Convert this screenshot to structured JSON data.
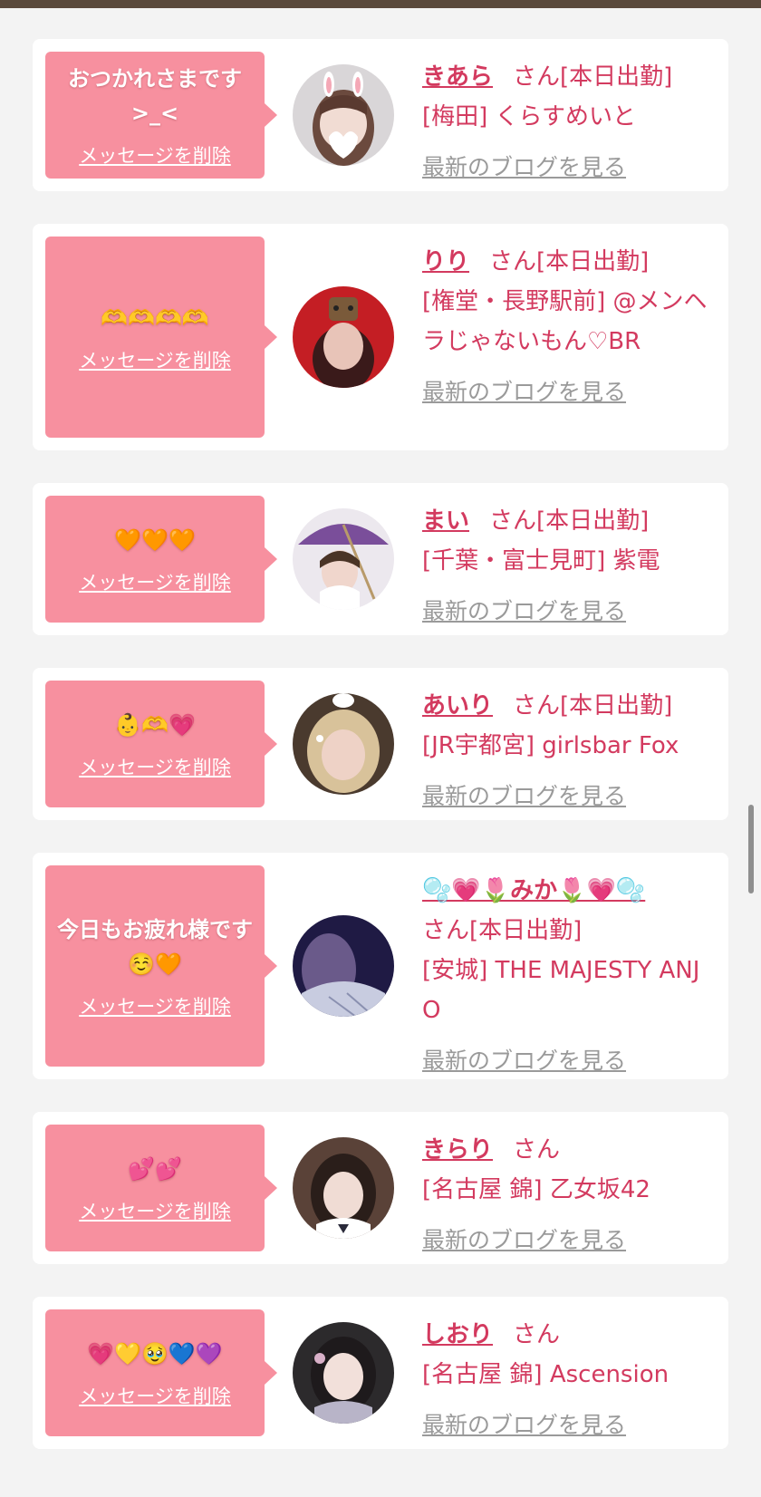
{
  "colors": {
    "bubble": "#f7909f",
    "accent_text": "#d33a5f",
    "blog_link": "#9a9a9a",
    "card": "#ffffff",
    "page_bg": "#f3f3f3"
  },
  "cards": [
    {
      "message": "おつかれさまです >_<",
      "delete_label": "メッセージを削除",
      "name": "きあら",
      "san": "さん",
      "status": "[本日出勤]",
      "shop": "[梅田] くらすめいと",
      "blog_label": "最新のブログを見る",
      "avatar_icon": "girl-avatar-bunny-ears"
    },
    {
      "message": "🫶🫶🫶🫶",
      "delete_label": "メッセージを削除",
      "name": "りり",
      "san": "さん",
      "status": "[本日出勤]",
      "shop": "[権堂・長野駅前] @メンヘラじゃないもん♡BR",
      "blog_label": "最新のブログを見る",
      "avatar_icon": "girl-avatar-red"
    },
    {
      "message": "🧡🧡🧡",
      "delete_label": "メッセージを削除",
      "name": "まい",
      "san": "さん",
      "status": "[本日出勤]",
      "shop": "[千葉・富士見町] 紫電",
      "blog_label": "最新のブログを見る",
      "avatar_icon": "girl-avatar-umbrella"
    },
    {
      "message": "👶🫶💗",
      "delete_label": "メッセージを削除",
      "name": "あいり",
      "san": "さん",
      "status": "[本日出勤]",
      "shop": "[JR宇都宮] girlsbar Fox",
      "blog_label": "最新のブログを見る",
      "avatar_icon": "girl-avatar-blonde"
    },
    {
      "message": "今日もお疲れ様です☺️🧡",
      "delete_label": "メッセージを削除",
      "name": "🫧💗🌷みか🌷💗🫧",
      "san": "さん",
      "status": "[本日出勤]",
      "shop": "[安城] THE MAJESTY ANJO",
      "blog_label": "最新のブログを見る",
      "avatar_icon": "girl-avatar-dark"
    },
    {
      "message": "💕💕",
      "delete_label": "メッセージを削除",
      "name": "きらり",
      "san": "さん",
      "status": "",
      "shop": "[名古屋 錦] 乙女坂42",
      "blog_label": "最新のブログを見る",
      "avatar_icon": "girl-avatar-uniform"
    },
    {
      "message": "💗💛🥹💙💜",
      "delete_label": "メッセージを削除",
      "name": "しおり",
      "san": "さん",
      "status": "",
      "shop": "[名古屋 錦] Ascension",
      "blog_label": "最新のブログを見る",
      "avatar_icon": "girl-avatar-kimono"
    }
  ]
}
